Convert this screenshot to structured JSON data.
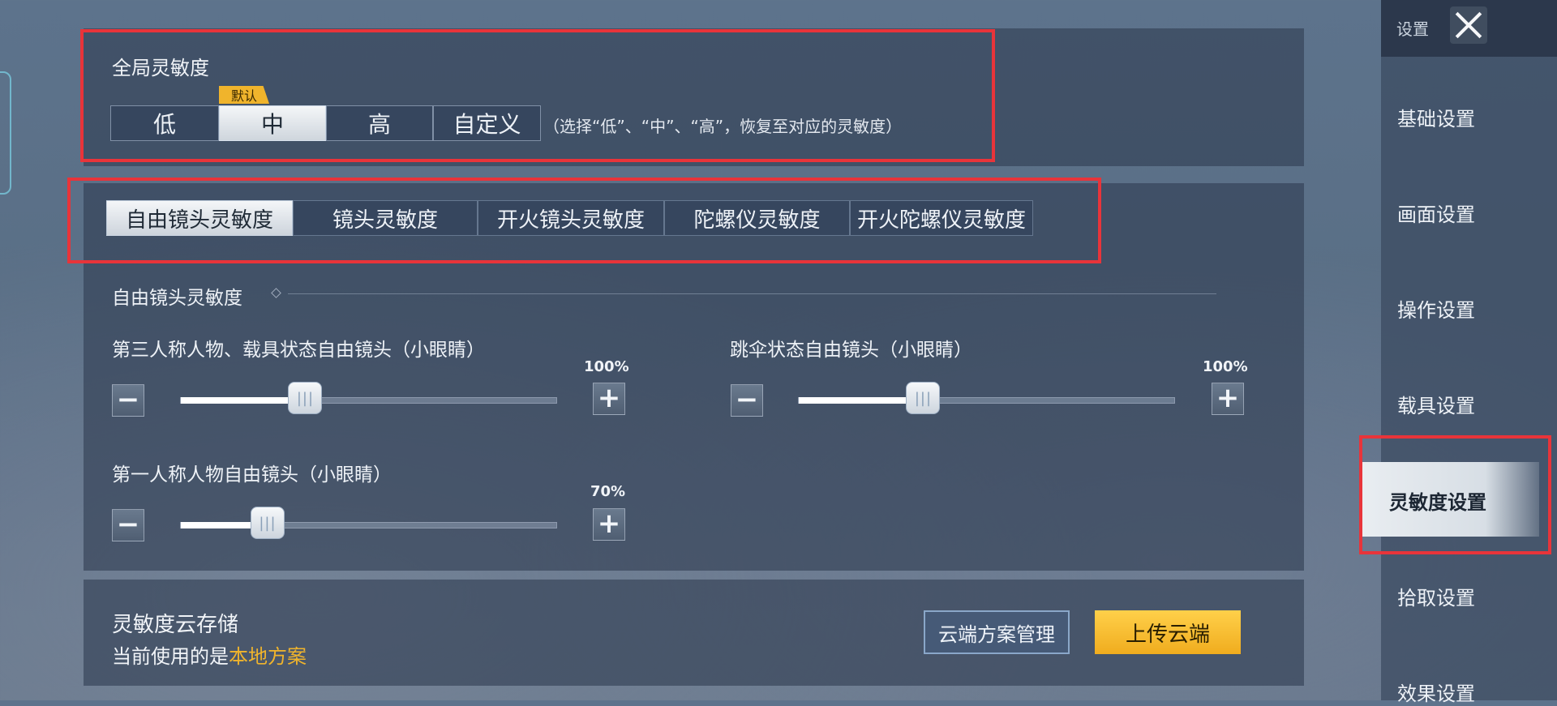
{
  "global": {
    "title": "全局灵敏度",
    "default_tag": "默认",
    "options": [
      "低",
      "中",
      "高",
      "自定义"
    ],
    "selected": "中",
    "hint": "（选择“低”、“中”、“高”，恢复至对应的灵敏度）"
  },
  "tabs": [
    {
      "label": "自由镜头灵敏度",
      "active": true
    },
    {
      "label": "镜头灵敏度",
      "active": false
    },
    {
      "label": "开火镜头灵敏度",
      "active": false
    },
    {
      "label": "陀螺仪灵敏度",
      "active": false
    },
    {
      "label": "开火陀螺仪灵敏度",
      "active": false
    }
  ],
  "section": {
    "title": "自由镜头灵敏度",
    "sliders": [
      {
        "label": "第三人称人物、载具状态自由镜头（小眼睛）",
        "value_label": "100%",
        "fill": 0.33
      },
      {
        "label": "跳伞状态自由镜头（小眼睛）",
        "value_label": "100%",
        "fill": 0.33
      },
      {
        "label": "第一人称人物自由镜头（小眼睛）",
        "value_label": "70%",
        "fill": 0.23
      }
    ],
    "minus": "−",
    "plus": "+",
    "thumb_grip": "|||"
  },
  "cloud": {
    "title": "灵敏度云存储",
    "current_prefix": "当前使用的是",
    "current_value": "本地方案",
    "manage_button": "云端方案管理",
    "upload_button": "上传云端"
  },
  "sidebar": {
    "header": "设置",
    "items": [
      "基础设置",
      "画面设置",
      "操作设置",
      "载具设置",
      "灵敏度设置",
      "拾取设置",
      "效果设置"
    ],
    "active": "灵敏度设置"
  },
  "colors": {
    "highlight_red": "#e8343a",
    "accent_gold": "#f0b42c"
  }
}
